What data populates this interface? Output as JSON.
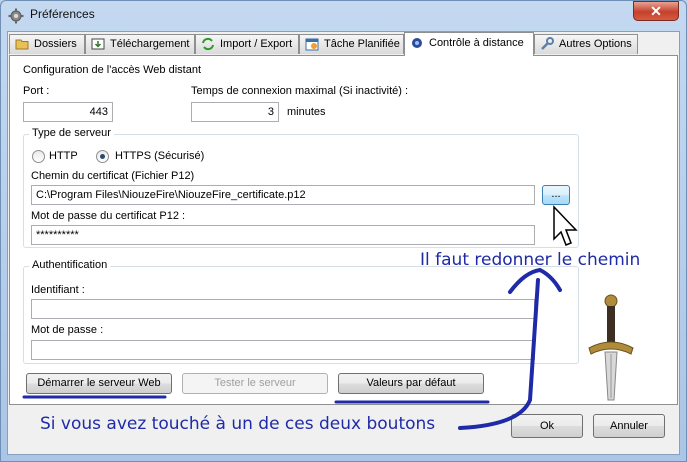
{
  "window": {
    "title": "Préférences",
    "close_label": "✕"
  },
  "tabs": [
    {
      "label": "Dossiers",
      "icon": "folder-icon"
    },
    {
      "label": "Téléchargement",
      "icon": "download-icon"
    },
    {
      "label": "Import / Export",
      "icon": "import-export-icon"
    },
    {
      "label": "Tâche Planifiée",
      "icon": "calendar-icon"
    },
    {
      "label": "Contrôle à distance",
      "icon": "remote-icon",
      "active": true
    },
    {
      "label": "Autres Options",
      "icon": "wrench-icon"
    }
  ],
  "section": {
    "title": "Configuration de l'accès Web distant",
    "port_label": "Port :",
    "port_value": "443",
    "timeout_label": "Temps de connexion maximal (Si inactivité) :",
    "timeout_value": "3",
    "timeout_unit": "minutes"
  },
  "server_type": {
    "legend": "Type de serveur",
    "http_label": "HTTP",
    "https_label": "HTTPS (Sécurisé)",
    "selected": "HTTPS (Sécurisé)",
    "cert_path_label": "Chemin du certificat (Fichier P12)",
    "cert_path_value": "C:\\Program Files\\NiouzeFire\\NiouzeFire_certificate.p12",
    "browse_label": "...",
    "cert_password_label": "Mot de passe du certificat P12 :",
    "cert_password_value": "**********"
  },
  "auth": {
    "legend": "Authentification",
    "identifier_label": "Identifiant :",
    "identifier_value": "",
    "password_label": "Mot de passe :",
    "password_value": ""
  },
  "buttons": {
    "start_server": "Démarrer le serveur Web",
    "test_server": "Tester le serveur",
    "defaults": "Valeurs par défaut",
    "ok": "Ok",
    "cancel": "Annuler"
  },
  "annotations": {
    "path_hint": "Il faut redonner le chemin",
    "buttons_hint": "Si vous avez touché à un de ces deux boutons"
  },
  "colors": {
    "annotation": "#1f2aa8",
    "accent": "#3c7fb1"
  }
}
